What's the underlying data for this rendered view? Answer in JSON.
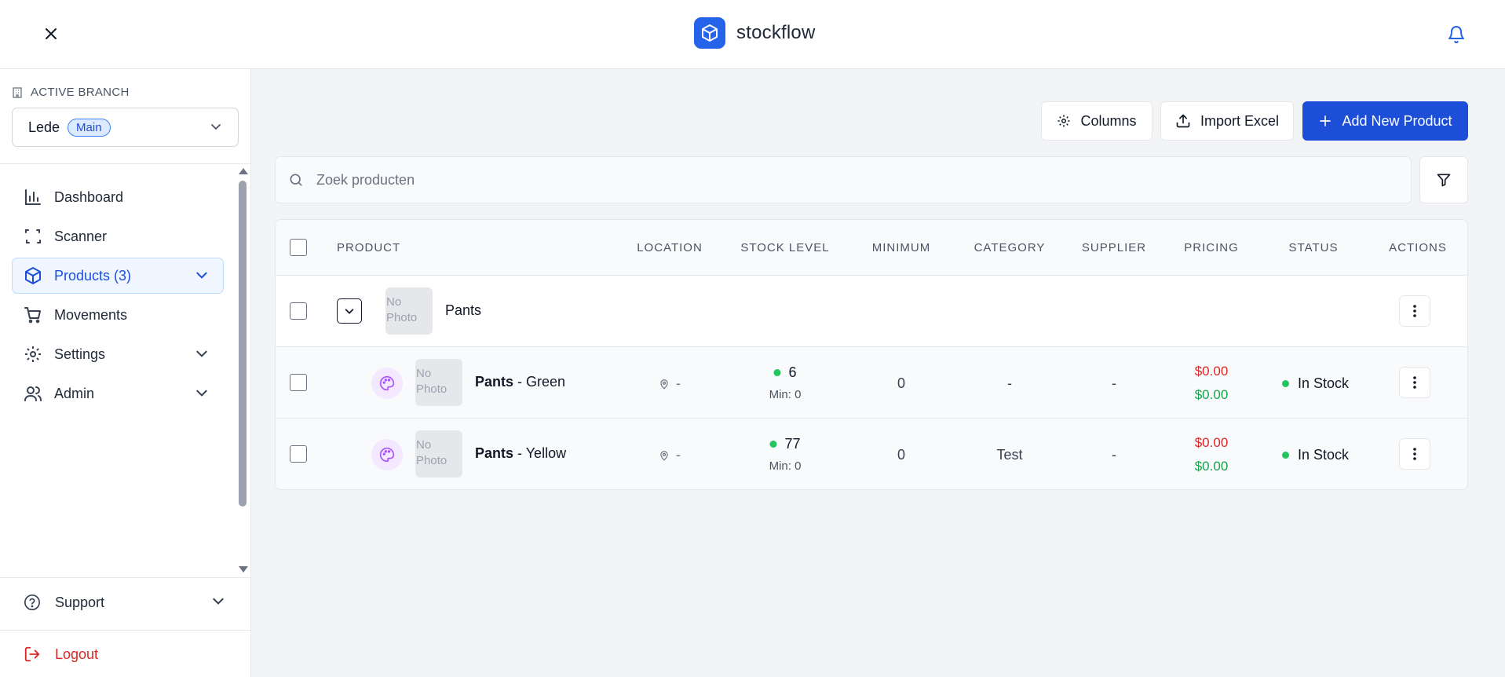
{
  "app": {
    "name": "stockflow"
  },
  "sidebar": {
    "branch_label": "ACTIVE BRANCH",
    "branch_name": "Lede",
    "branch_badge": "Main",
    "items": [
      {
        "label": "Dashboard",
        "icon": "bar-chart-icon"
      },
      {
        "label": "Scanner",
        "icon": "scan-icon"
      },
      {
        "label": "Products (3)",
        "icon": "box-icon",
        "active": true
      },
      {
        "label": "Movements",
        "icon": "cart-icon"
      },
      {
        "label": "Settings",
        "icon": "gear-icon"
      },
      {
        "label": "Admin",
        "icon": "users-icon"
      }
    ],
    "support_label": "Support",
    "logout_label": "Logout"
  },
  "toolbar": {
    "columns_label": "Columns",
    "import_label": "Import Excel",
    "add_label": "Add New Product"
  },
  "search": {
    "placeholder": "Zoek producten",
    "value": ""
  },
  "table": {
    "headers": {
      "product": "PRODUCT",
      "location": "LOCATION",
      "stock_level": "STOCK LEVEL",
      "minimum": "MINIMUM",
      "category": "CATEGORY",
      "supplier": "SUPPLIER",
      "pricing": "PRICING",
      "status": "STATUS",
      "actions": "ACTIONS"
    },
    "no_photo_line1": "No",
    "no_photo_line2": "Photo",
    "group": {
      "name": "Pants"
    },
    "rows": [
      {
        "name": "Pants",
        "variant": " - Green",
        "location": "-",
        "stock": "6",
        "stock_min": "Min: 0",
        "minimum": "0",
        "category": "-",
        "supplier": "-",
        "price_cost": "$0.00",
        "price_sale": "$0.00",
        "status": "In Stock"
      },
      {
        "name": "Pants",
        "variant": " - Yellow",
        "location": "-",
        "stock": "77",
        "stock_min": "Min: 0",
        "minimum": "0",
        "category": "Test",
        "supplier": "-",
        "price_cost": "$0.00",
        "price_sale": "$0.00",
        "status": "In Stock"
      }
    ]
  },
  "colors": {
    "primary": "#1d4ed8",
    "brand": "#2563eb",
    "danger": "#dc2626",
    "success": "#16a34a",
    "status_dot": "#22c55e"
  }
}
